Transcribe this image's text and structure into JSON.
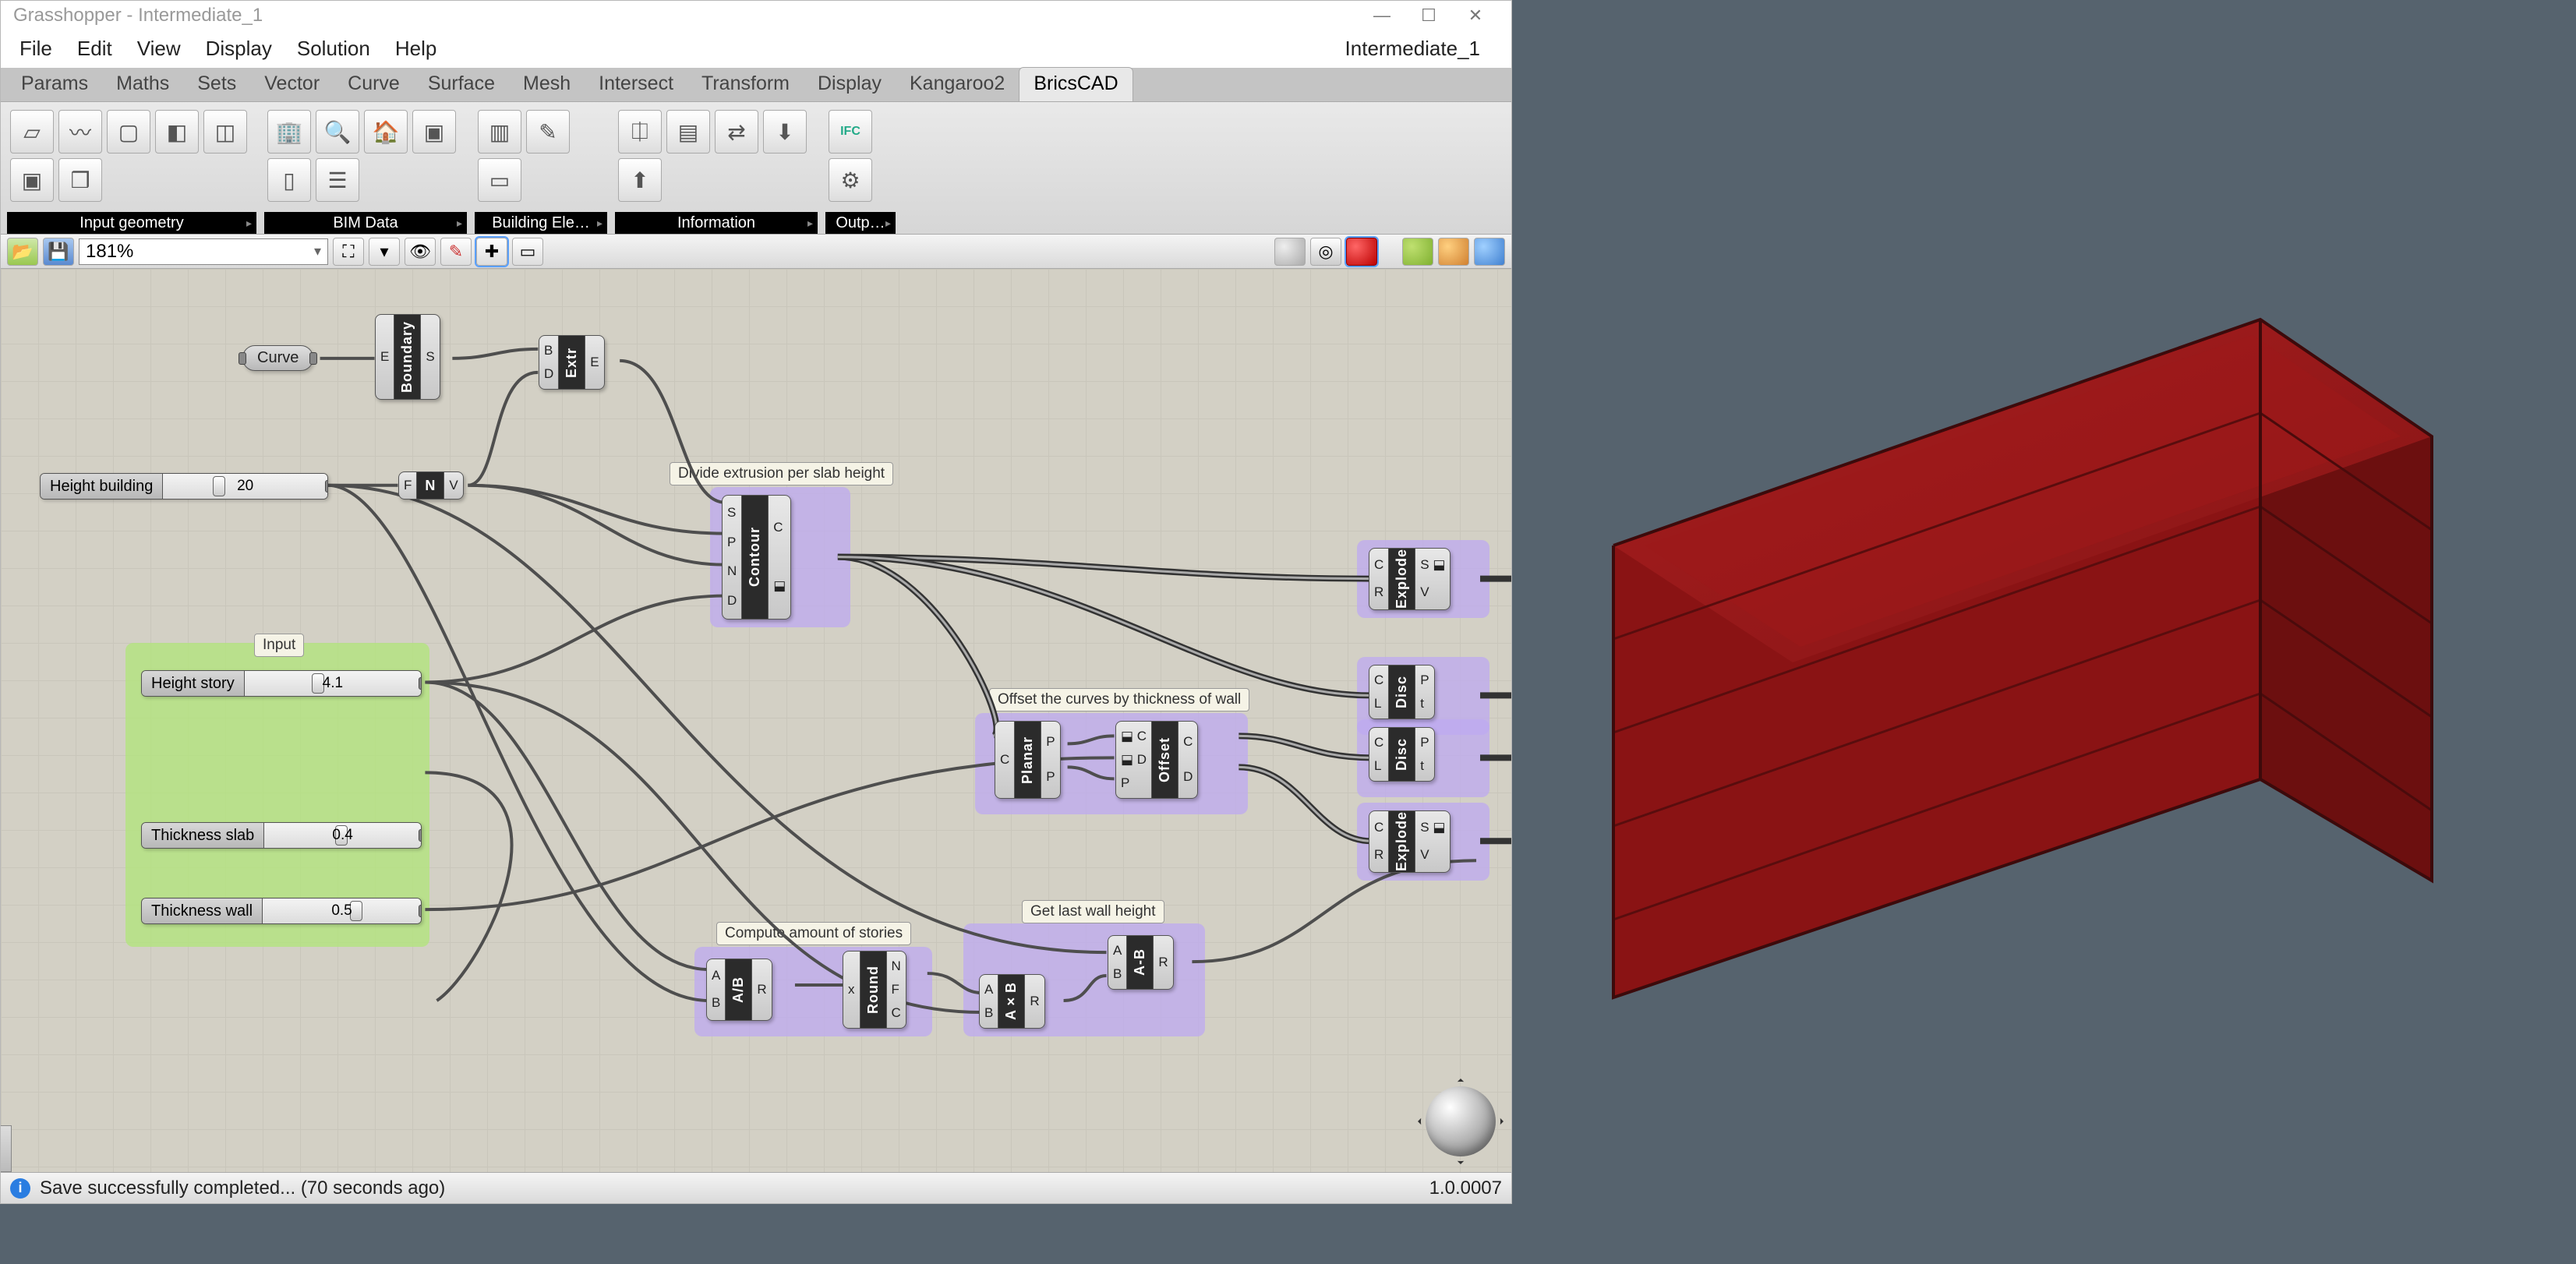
{
  "window": {
    "title": "Grasshopper - Intermediate_1"
  },
  "menus": [
    "File",
    "Edit",
    "View",
    "Display",
    "Solution",
    "Help"
  ],
  "document_name": "Intermediate_1",
  "tabs": [
    "Params",
    "Maths",
    "Sets",
    "Vector",
    "Curve",
    "Surface",
    "Mesh",
    "Intersect",
    "Transform",
    "Display",
    "Kangaroo2",
    "BricsCAD"
  ],
  "active_tab": "BricsCAD",
  "ribbon_groups": [
    "Input geometry",
    "BIM Data",
    "Building Ele…",
    "Information",
    "Outp…"
  ],
  "zoom": "181%",
  "statusbar": {
    "message": "Save successfully completed... (70 seconds ago)",
    "version": "1.0.0007"
  },
  "params": {
    "curve_label": "Curve",
    "height_building": {
      "label": "Height building",
      "value": "20"
    },
    "height_story": {
      "label": "Height story",
      "value": "4.1"
    },
    "thickness_slab": {
      "label": "Thickness slab",
      "value": "0.4"
    },
    "thickness_wall": {
      "label": "Thickness wall",
      "value": "0.5"
    }
  },
  "scribbles": {
    "input": "Input",
    "divide": "Divide extrusion per slab height",
    "offset": "Offset the curves by thickness of wall",
    "stories": "Compute amount of stories",
    "lastwall": "Get last wall height"
  },
  "components": {
    "boundary": {
      "name": "Boundary",
      "in": [
        "E"
      ],
      "out": [
        "S"
      ]
    },
    "extr": {
      "name": "Extr",
      "in": [
        "B",
        "D"
      ],
      "out": [
        "E"
      ]
    },
    "neg": {
      "name": "N",
      "in": [
        "F"
      ],
      "out": [
        "V"
      ]
    },
    "contour": {
      "name": "Contour",
      "in": [
        "S",
        "P",
        "N",
        "D"
      ],
      "out": [
        "C"
      ]
    },
    "planar": {
      "name": "Planar",
      "in": [
        "C"
      ],
      "out": [
        "P",
        "P"
      ]
    },
    "offset": {
      "name": "Offset",
      "in": [
        "C",
        "D",
        "P"
      ],
      "out": [
        "C",
        "D"
      ]
    },
    "explode1": {
      "name": "Explode",
      "in": [
        "C",
        "R"
      ],
      "out": [
        "S",
        "V"
      ]
    },
    "disc1": {
      "name": "Disc",
      "in": [
        "C",
        "L"
      ],
      "out": [
        "P",
        "t"
      ]
    },
    "disc2": {
      "name": "Disc",
      "in": [
        "C",
        "L"
      ],
      "out": [
        "P",
        "t"
      ]
    },
    "explode2": {
      "name": "Explode",
      "in": [
        "C",
        "R"
      ],
      "out": [
        "S",
        "V"
      ]
    },
    "div": {
      "name": "A/B",
      "in": [
        "A",
        "B"
      ],
      "out": [
        "R"
      ]
    },
    "round": {
      "name": "Round",
      "in": [
        "x"
      ],
      "out": [
        "N",
        "F",
        "C"
      ]
    },
    "mult": {
      "name": "A×B",
      "in": [
        "A",
        "B"
      ],
      "out": [
        "R"
      ]
    },
    "sub": {
      "name": "A-B",
      "in": [
        "A",
        "B"
      ],
      "out": [
        "R"
      ]
    }
  }
}
